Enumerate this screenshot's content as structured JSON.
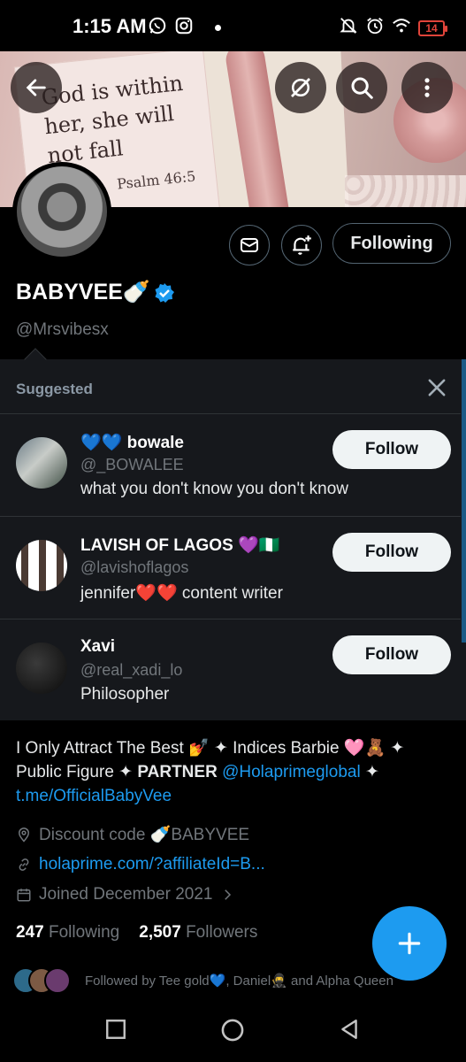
{
  "status_bar": {
    "time": "1:15 AM",
    "battery": "14",
    "icons": [
      "whatsapp-icon",
      "instagram-icon",
      "dot",
      "mute-icon",
      "alarm-icon",
      "wifi-icon",
      "battery-icon"
    ]
  },
  "banner": {
    "verse_lines": [
      "God is within",
      "her, she will",
      "not fall"
    ],
    "verse_ref": "Psalm 46:5"
  },
  "profile": {
    "display_name": "BABYVEE🍼",
    "handle": "@Mrsvibesx",
    "following_button": "Following"
  },
  "suggested": {
    "title": "Suggested",
    "accounts": [
      {
        "name": "💙💙 bowale",
        "handle": "@_BOWALEE",
        "bio": "what you don't know you don't know",
        "button": "Follow"
      },
      {
        "name": "LAVISH OF LAGOS 💜🇳🇬",
        "handle": "@lavishoflagos",
        "bio": "jennifer❤️❤️  content writer",
        "button": "Follow"
      },
      {
        "name": "Xavi",
        "handle": "@real_xadi_lo",
        "bio": "Philosopher",
        "button": "Follow"
      }
    ]
  },
  "bio": {
    "line1": "I Only Attract The Best 💅 ✦ Indices Barbie 🩷🧸 ✦",
    "line2_text": "Public Figure ✦ ",
    "line2_bold": "PARTNER",
    "mention": "@Holaprimeglobal",
    "sep": " ✦ ",
    "link": "t.me/OfficialBabyVee"
  },
  "meta": {
    "location": "Discount code 🍼BABYVEE",
    "website": "holaprime.com/?affiliateId=B...",
    "joined": "Joined December 2021"
  },
  "stats": {
    "following_count": "247",
    "following_label": "Following",
    "followers_count": "2,507",
    "followers_label": "Followers"
  },
  "followed_by": "Followed by Tee gold💙, Daniel🥷 and Alpha Queen",
  "colors": {
    "accent": "#1d9bf0",
    "background": "#000000",
    "card": "#16181c",
    "muted": "#71767b"
  }
}
